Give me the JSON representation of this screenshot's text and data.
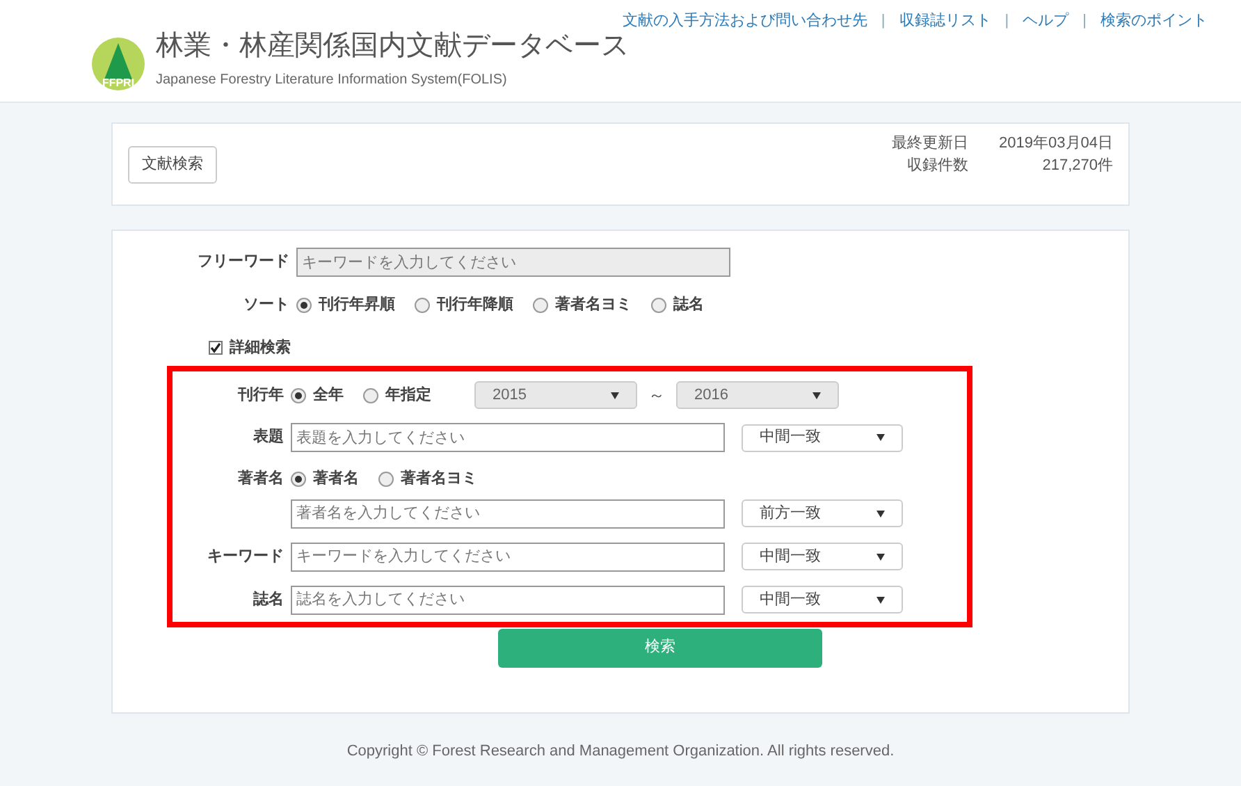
{
  "header": {
    "links": [
      "文献の入手方法および問い合わせ先",
      "収録誌リスト",
      "ヘルプ",
      "検索のポイント"
    ],
    "separator": "|",
    "logo_text": "FFPRI",
    "title": "林業・林産関係国内文献データベース",
    "subtitle": "Japanese Forestry Literature Information System(FOLIS)"
  },
  "info_card": {
    "tab_button": "文献検索",
    "rows": [
      {
        "label": "最終更新日",
        "value": "2019年03月04日"
      },
      {
        "label": "収録件数",
        "value": "217,270件"
      }
    ]
  },
  "form": {
    "free_word": {
      "label": "フリーワード",
      "placeholder": "キーワードを入力してください"
    },
    "sort": {
      "label": "ソート",
      "options": [
        {
          "label": "刊行年昇順",
          "selected": true
        },
        {
          "label": "刊行年降順",
          "selected": false
        },
        {
          "label": "著者名ヨミ",
          "selected": false
        },
        {
          "label": "誌名",
          "selected": false
        }
      ]
    },
    "detail_search": {
      "label": "詳細検索",
      "checked": true
    },
    "year": {
      "label": "刊行年",
      "options": [
        {
          "label": "全年",
          "selected": true
        },
        {
          "label": "年指定",
          "selected": false
        }
      ],
      "from": "2015",
      "separator": "～",
      "to": "2016",
      "disabled": true
    },
    "fields": [
      {
        "kind": "text",
        "label": "表題",
        "placeholder": "表題を入力してください",
        "match": "中間一致"
      },
      {
        "kind": "author",
        "label": "著者名",
        "options": [
          {
            "label": "著者名",
            "selected": true
          },
          {
            "label": "著者名ヨミ",
            "selected": false
          }
        ],
        "placeholder": "著者名を入力してください",
        "match": "前方一致"
      },
      {
        "kind": "text",
        "label": "キーワード",
        "placeholder": "キーワードを入力してください",
        "match": "中間一致"
      },
      {
        "kind": "text",
        "label": "誌名",
        "placeholder": "誌名を入力してください",
        "match": "中間一致"
      }
    ],
    "search_button": "検索"
  },
  "footer": "Copyright © Forest Research and Management Organization. All rights reserved."
}
